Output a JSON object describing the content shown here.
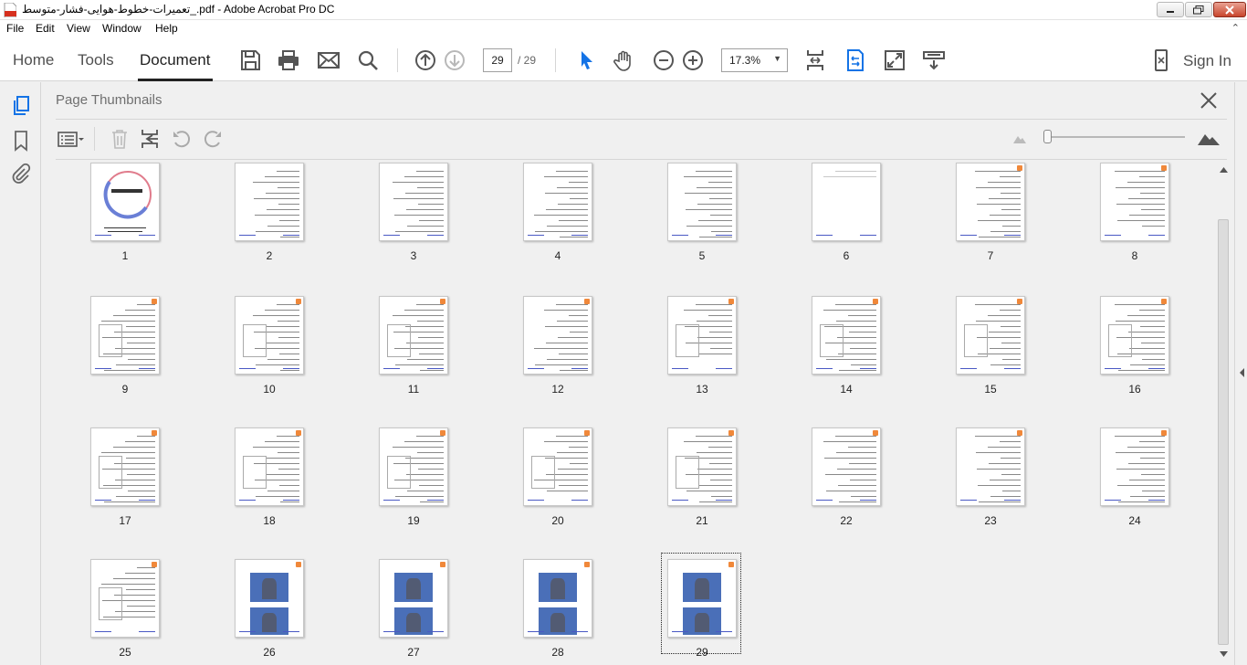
{
  "window": {
    "title": "تعميرات-خطوط-هوايى-فشار-متوسط_.pdf - Adobe Acrobat Pro DC"
  },
  "menu": {
    "items": [
      "File",
      "Edit",
      "View",
      "Window",
      "Help"
    ]
  },
  "nav_tabs": {
    "home": "Home",
    "tools": "Tools",
    "document": "Document"
  },
  "toolbar": {
    "page_current": "29",
    "page_total": "/ 29",
    "zoom": "17.3%",
    "sign_in": "Sign In"
  },
  "panel": {
    "title": "Page Thumbnails"
  },
  "thumbnails": {
    "selected_page": 29,
    "pages": [
      "1",
      "2",
      "3",
      "4",
      "5",
      "6",
      "7",
      "8",
      "9",
      "10",
      "11",
      "12",
      "13",
      "14",
      "15",
      "16",
      "17",
      "18",
      "19",
      "20",
      "21",
      "22",
      "23",
      "24",
      "25",
      "26",
      "27",
      "28",
      "29"
    ]
  },
  "colors": {
    "accent": "#1473e6",
    "photo_blue": "#4a6fb8",
    "logo_orange": "#f0883a"
  },
  "icons": {
    "toolbar": [
      "save-icon",
      "print-icon",
      "email-icon",
      "search-icon",
      "prev-page-icon",
      "next-page-icon",
      "select-arrow-icon",
      "hand-icon",
      "zoom-out-icon",
      "zoom-in-icon",
      "fit-page-icon",
      "scrolling-mode-icon",
      "full-screen-icon",
      "read-mode-icon",
      "mobile-icon"
    ],
    "rail": [
      "page-thumbnails-icon",
      "bookmarks-icon",
      "attachments-icon"
    ]
  }
}
